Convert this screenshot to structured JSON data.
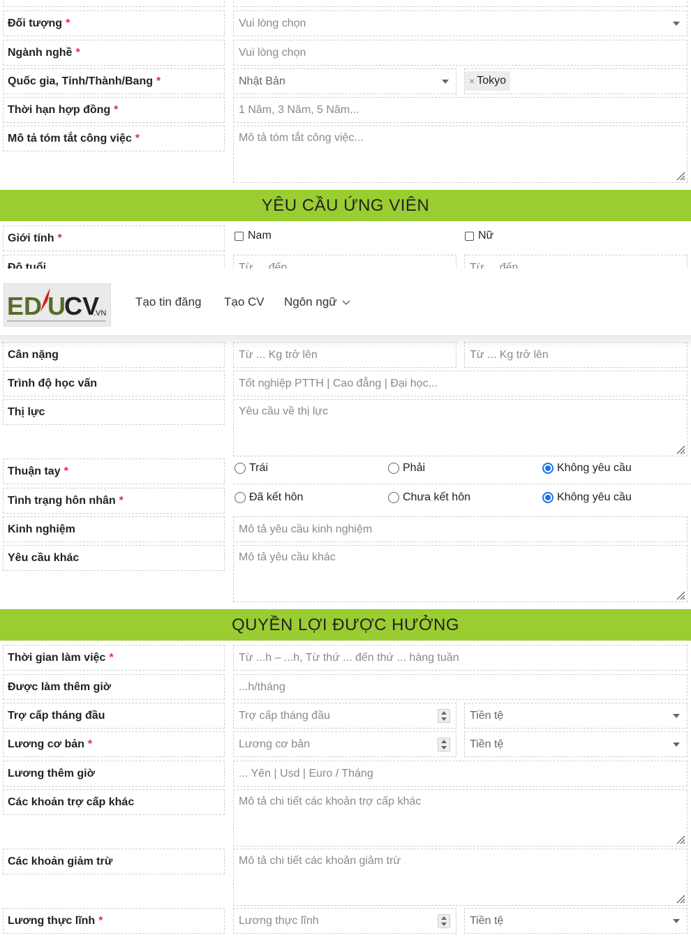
{
  "section_job": {
    "rows": [
      {
        "label": "Đối tượng",
        "placeholder": "Vui lòng chọn"
      },
      {
        "label": "Ngành nghề",
        "placeholder": "Vui lòng chọn"
      },
      {
        "label": "Quốc gia, Tỉnh/Thành/Bang",
        "country": "Nhật Bản",
        "city_tag": "Tokyo"
      },
      {
        "label": "Thời hạn hợp đồng",
        "placeholder": "1 Năm, 3 Năm, 5 Năm..."
      },
      {
        "label": "Mô tả tóm tắt công việc",
        "placeholder": "Mô tả tóm tắt công việc..."
      }
    ]
  },
  "section_candidate": {
    "title": "YÊU CẦU ỨNG VIÊN",
    "gender_label": "Giới tính",
    "gender_options": [
      "Nam",
      "Nữ"
    ],
    "age_label": "Độ tuổi",
    "age_from": "Từ ... đến",
    "age_to": "Từ ... đến",
    "weight_label": "Cân nặng",
    "weight_from": "Từ ... Kg trở lên",
    "weight_to": "Từ ... Kg trở lên",
    "education_label": "Trình độ học vấn",
    "education_placeholder": "Tốt nghiệp PTTH | Cao đẳng | Đại học...",
    "vision_label": "Thị lực",
    "vision_placeholder": "Yêu cầu về thị lực",
    "hand_label": "Thuận tay",
    "hand_options": [
      "Trái",
      "Phải",
      "Không yêu cầu"
    ],
    "marital_label": "Tình trạng hôn nhân",
    "marital_options": [
      "Đã kết hôn",
      "Chưa kết hôn",
      "Không yêu cầu"
    ],
    "experience_label": "Kinh nghiệm",
    "experience_placeholder": "Mô tả yêu cầu kinh nghiệm",
    "other_label": "Yêu cầu khác",
    "other_placeholder": "Mô tả yêu cầu khác"
  },
  "section_benefits": {
    "title": "QUYỀN LỢI ĐƯỢC HƯỞNG",
    "work_time_label": "Thời gian làm việc",
    "work_time_placeholder": "Từ ...h – ...h, Từ thứ ... đến thứ ... hàng tuần",
    "overtime_label": "Được làm thêm giờ",
    "overtime_placeholder": "...h/tháng",
    "first_allowance_label": "Trợ cấp tháng đầu",
    "first_allowance_placeholder": "Trợ cấp tháng đầu",
    "currency_placeholder": "Tiền tệ",
    "base_salary_label": "Lương cơ bản",
    "base_salary_placeholder": "Lương cơ bản",
    "ot_salary_label": "Lương thêm giờ",
    "ot_salary_placeholder": "... Yên | Usd | Euro / Tháng",
    "other_allowance_label": "Các khoản trợ cấp khác",
    "other_allowance_placeholder": "Mô tả chi tiết các khoản trợ cấp khác",
    "deduction_label": "Các khoản giảm trừ",
    "deduction_placeholder": "Mô tả chi tiết các khoản giảm trừ",
    "net_salary_label": "Lương thực lĩnh",
    "net_salary_placeholder": "Lương thực lĩnh"
  },
  "navbar": {
    "logo_text": "EDUCV",
    "logo_suffix": ".VN",
    "links": [
      "Tạo tin đăng",
      "Tạo CV",
      "Ngôn ngữ"
    ]
  },
  "colors": {
    "banner": "#9acd32",
    "required": "#e8265a",
    "radio_on": "#1a73e8"
  }
}
